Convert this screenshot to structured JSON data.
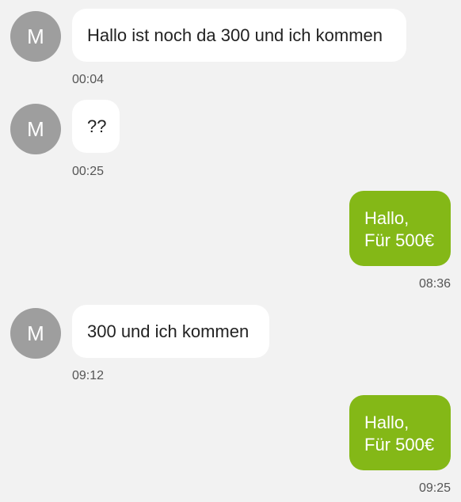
{
  "messages": [
    {
      "direction": "incoming",
      "avatar_letter": "M",
      "lines": [
        "Hallo ist noch da 300 und ich kommen"
      ],
      "time": "00:04"
    },
    {
      "direction": "incoming",
      "avatar_letter": "M",
      "lines": [
        "??"
      ],
      "time": "00:25"
    },
    {
      "direction": "outgoing",
      "lines": [
        "Hallo,",
        "Für 500€"
      ],
      "time": "08:36"
    },
    {
      "direction": "incoming",
      "avatar_letter": "M",
      "lines": [
        "300 und ich kommen"
      ],
      "time": "09:12"
    },
    {
      "direction": "outgoing",
      "lines": [
        "Hallo,",
        "Für 500€"
      ],
      "time": "09:25"
    }
  ],
  "colors": {
    "background": "#f2f2f2",
    "incoming_bubble": "#ffffff",
    "outgoing_bubble": "#84b817",
    "avatar": "#9e9e9e",
    "timestamp_text": "#555555"
  }
}
